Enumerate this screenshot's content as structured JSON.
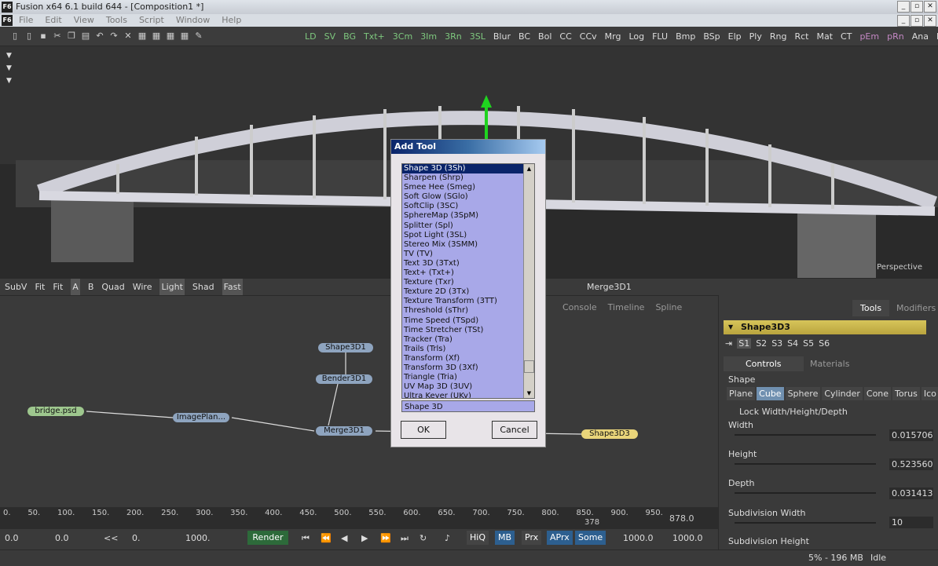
{
  "window": {
    "title": "Fusion x64 6.1 build 644 - [Composition1 *]",
    "logo": "F6"
  },
  "menu": [
    "File",
    "Edit",
    "View",
    "Tools",
    "Script",
    "Window",
    "Help"
  ],
  "toolbar": {
    "tools": [
      "LD",
      "SV",
      "BG",
      "Txt+",
      "3Cm",
      "3Im",
      "3Rn",
      "3SL",
      "Blur",
      "BC",
      "Bol",
      "CC",
      "CCv",
      "Mrg",
      "Log",
      "FLU",
      "Bmp",
      "BSp",
      "Elp",
      "Ply",
      "Rng",
      "Rct",
      "Mat",
      "CT",
      "pEm",
      "pRn",
      "Ana",
      "Rs"
    ]
  },
  "viewer": {
    "perspective_label": "Perspective"
  },
  "viewer_bar": {
    "items": [
      "SubV",
      "Fit",
      "Fit",
      "A",
      "B",
      "Quad",
      "Wire",
      "Light",
      "Shad",
      "Fast"
    ],
    "node_name": "Merge3D1"
  },
  "flow": {
    "tabs": [
      "Console",
      "Timeline",
      "Spline"
    ],
    "nodes": {
      "shape3d1": "Shape3D1",
      "bender3d1": "Bender3D1",
      "bridge": "bridge.psd",
      "imageplane": "ImagePlan...",
      "merge3d1": "Merge3D1",
      "shape3d3": "Shape3D3"
    }
  },
  "dialog": {
    "title": "Add Tool",
    "items": [
      "Shape 3D (3Sh)",
      "Sharpen (Shrp)",
      "Smee Hee (Smeg)",
      "Soft Glow (SGlo)",
      "SoftClip (3SC)",
      "SphereMap (3SpM)",
      "Splitter (Spl)",
      "Spot Light (3SL)",
      "Stereo Mix (3SMM)",
      "TV (TV)",
      "Text 3D (3Txt)",
      "Text+ (Txt+)",
      "Texture (Txr)",
      "Texture 2D (3Tx)",
      "Texture Transform (3TT)",
      "Threshold (sThr)",
      "Time Speed (TSpd)",
      "Time Stretcher (TSt)",
      "Tracker (Tra)",
      "Trails (Trls)",
      "Transform (Xf)",
      "Transform 3D (3Xf)",
      "Triangle (Tria)",
      "UV Map 3D (3UV)",
      "Ultra Keyer (UKy)"
    ],
    "input_value": "Shape 3D",
    "ok": "OK",
    "cancel": "Cancel"
  },
  "panel": {
    "tab_tools": "Tools",
    "tab_modifiers": "Modifiers",
    "header": "Shape3D3",
    "slots": [
      "S1",
      "S2",
      "S3",
      "S4",
      "S5",
      "S6"
    ],
    "tab_controls": "Controls",
    "tab_materials": "Materials",
    "shape_label": "Shape",
    "shapes": [
      "Plane",
      "Cube",
      "Sphere",
      "Cylinder",
      "Cone",
      "Torus",
      "Ico"
    ],
    "lock_label": "Lock Width/Height/Depth",
    "width_label": "Width",
    "width_value": "0.015706",
    "height_label": "Height",
    "height_value": "0.523560",
    "depth_label": "Depth",
    "depth_value": "0.031413",
    "subdiv_width_label": "Subdivision Width",
    "subdiv_width_value": "10",
    "subdiv_height_label": "Subdivision Height"
  },
  "timeline": {
    "ticks": [
      "0.",
      "50.",
      "100.",
      "150.",
      "200.",
      "250.",
      "300.",
      "350.",
      "400.",
      "450.",
      "500.",
      "550.",
      "600.",
      "650.",
      "700.",
      "750.",
      "800.",
      "850.",
      "900.",
      "950."
    ],
    "current": "378",
    "end_value": "878.0"
  },
  "transport": {
    "start": "0.0",
    "start2": "0.0",
    "range_start": "0.",
    "range_end": "1000.",
    "render": "Render",
    "hiq": "HiQ",
    "mb": "MB",
    "prx": "Prx",
    "aprx": "APrx",
    "some": "Some",
    "end1": "1000.0",
    "end2": "1000.0"
  },
  "status": {
    "memory": "5% - 196 MB",
    "state": "Idle"
  }
}
